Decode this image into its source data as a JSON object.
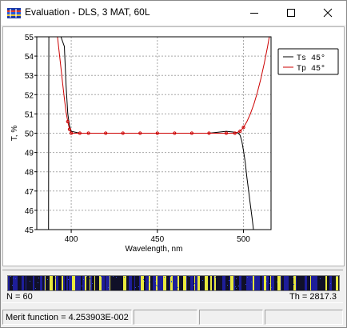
{
  "window": {
    "title": "Evaluation - DLS, 3 MAT, 60L",
    "icon": "evaluation-app-icon",
    "controls": [
      "minimize-icon",
      "maximize-icon",
      "close-icon"
    ]
  },
  "chart_data": {
    "type": "line",
    "title": "",
    "xlabel": "Wavelength, nm",
    "ylabel": "T, %",
    "xlim": [
      380,
      516
    ],
    "ylim": [
      45,
      55
    ],
    "x_ticks": [
      400,
      450,
      500
    ],
    "y_ticks": [
      45,
      46,
      47,
      48,
      49,
      50,
      51,
      52,
      53,
      54,
      55
    ],
    "grid": true,
    "legend_position": "top-right",
    "series": [
      {
        "name": "Ts 45°",
        "color": "#000000",
        "x": [
          386.8,
          387,
          388,
          390,
          392,
          394,
          396,
          397,
          398,
          399,
          400,
          405,
          410,
          420,
          430,
          440,
          450,
          460,
          470,
          480,
          490,
          495,
          497,
          498,
          499,
          500,
          501,
          502,
          503,
          504,
          505,
          505.8
        ],
        "y": [
          45,
          55,
          55,
          55,
          55,
          55,
          54.5,
          52.5,
          51.0,
          50.4,
          50.1,
          50.0,
          50.0,
          50.0,
          50.0,
          50.0,
          50.0,
          50.0,
          50.0,
          50.0,
          50.1,
          50.05,
          50.0,
          49.9,
          49.6,
          49.1,
          48.5,
          47.7,
          47.0,
          46.3,
          45.6,
          45
        ]
      },
      {
        "name": "Tp 45°",
        "color": "#cc0000",
        "x": [
          386,
          388,
          390,
          392,
          394,
          395,
          396,
          397,
          398,
          399,
          400,
          405,
          410,
          420,
          430,
          440,
          450,
          460,
          470,
          480,
          490,
          495,
          498,
          500,
          502,
          504,
          506,
          508,
          510,
          512,
          514,
          515
        ],
        "y": [
          55,
          55,
          55,
          55,
          53.4,
          52.6,
          51.8,
          51.1,
          50.6,
          50.2,
          50.0,
          50.0,
          50.0,
          50.0,
          50.0,
          50.0,
          50.0,
          50.0,
          50.0,
          50.0,
          50.0,
          50.0,
          50.1,
          50.3,
          50.6,
          51.0,
          51.5,
          52.1,
          52.8,
          53.6,
          54.5,
          55
        ]
      }
    ]
  },
  "structure": {
    "layer_colors": [
      "#1e1e9a",
      "#e8e83c",
      "#101028"
    ],
    "n_label": "N = 60",
    "th_label": "Th = 2817.3"
  },
  "status": {
    "merit": "Merit function =  4.253903E-002"
  }
}
